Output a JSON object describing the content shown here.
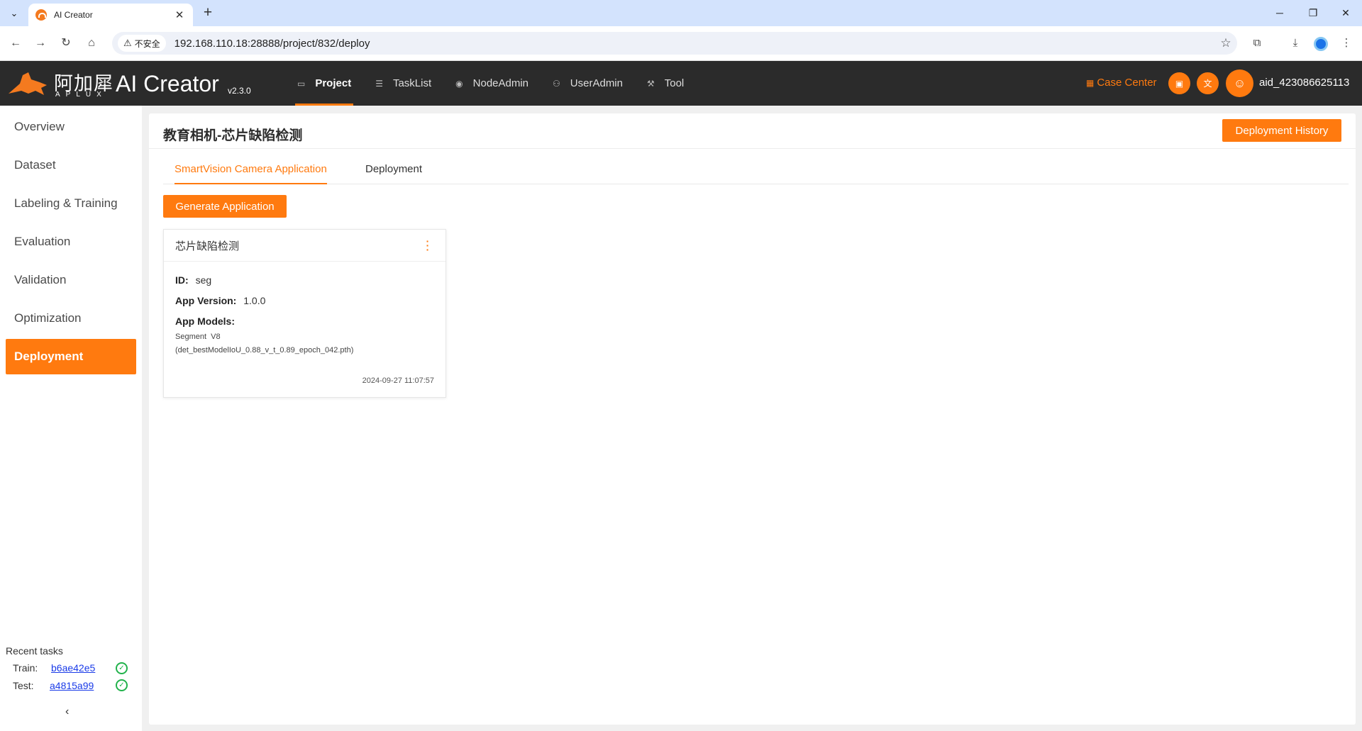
{
  "browser": {
    "tab_title": "AI Creator",
    "security_label": "不安全",
    "url": "192.168.110.18:28888/project/832/deploy"
  },
  "header": {
    "logo_cn": "阿加犀",
    "logo_en": "APLUX",
    "app_title": "AI Creator",
    "version": "v2.3.0",
    "nav": [
      {
        "label": "Project",
        "icon": "folder-icon",
        "active": true
      },
      {
        "label": "TaskList",
        "icon": "list-icon",
        "active": false
      },
      {
        "label": "NodeAdmin",
        "icon": "node-icon",
        "active": false
      },
      {
        "label": "UserAdmin",
        "icon": "users-icon",
        "active": false
      },
      {
        "label": "Tool",
        "icon": "wrench-icon",
        "active": false
      }
    ],
    "case_center": "Case Center",
    "username": "aid_423086625113"
  },
  "sidebar": {
    "items": [
      {
        "label": "Overview"
      },
      {
        "label": "Dataset"
      },
      {
        "label": "Labeling & Training"
      },
      {
        "label": "Evaluation"
      },
      {
        "label": "Validation"
      },
      {
        "label": "Optimization"
      },
      {
        "label": "Deployment",
        "active": true
      }
    ],
    "recent_title": "Recent tasks",
    "recent": [
      {
        "label": "Train:",
        "id": "b6ae42e5",
        "status": "success"
      },
      {
        "label": "Test:",
        "id": "a4815a99",
        "status": "success"
      }
    ]
  },
  "main": {
    "title": "教育相机-芯片缺陷检测",
    "history_button": "Deployment History",
    "tabs": [
      {
        "label": "SmartVision Camera Application",
        "active": true
      },
      {
        "label": "Deployment",
        "active": false
      }
    ],
    "generate_button": "Generate Application",
    "card": {
      "name": "芯片缺陷检测",
      "id_label": "ID:",
      "id_value": "seg",
      "version_label": "App Version:",
      "version_value": "1.0.0",
      "models_label": "App Models:",
      "models_line1": "Segment  V8",
      "models_line2": "(det_bestModelIoU_0.88_v_t_0.89_epoch_042.pth)",
      "time": "2024-09-27 11:07:57"
    }
  },
  "colors": {
    "accent": "#ff7a0f",
    "header_bg": "#2b2b2b",
    "success": "#22b24c"
  }
}
